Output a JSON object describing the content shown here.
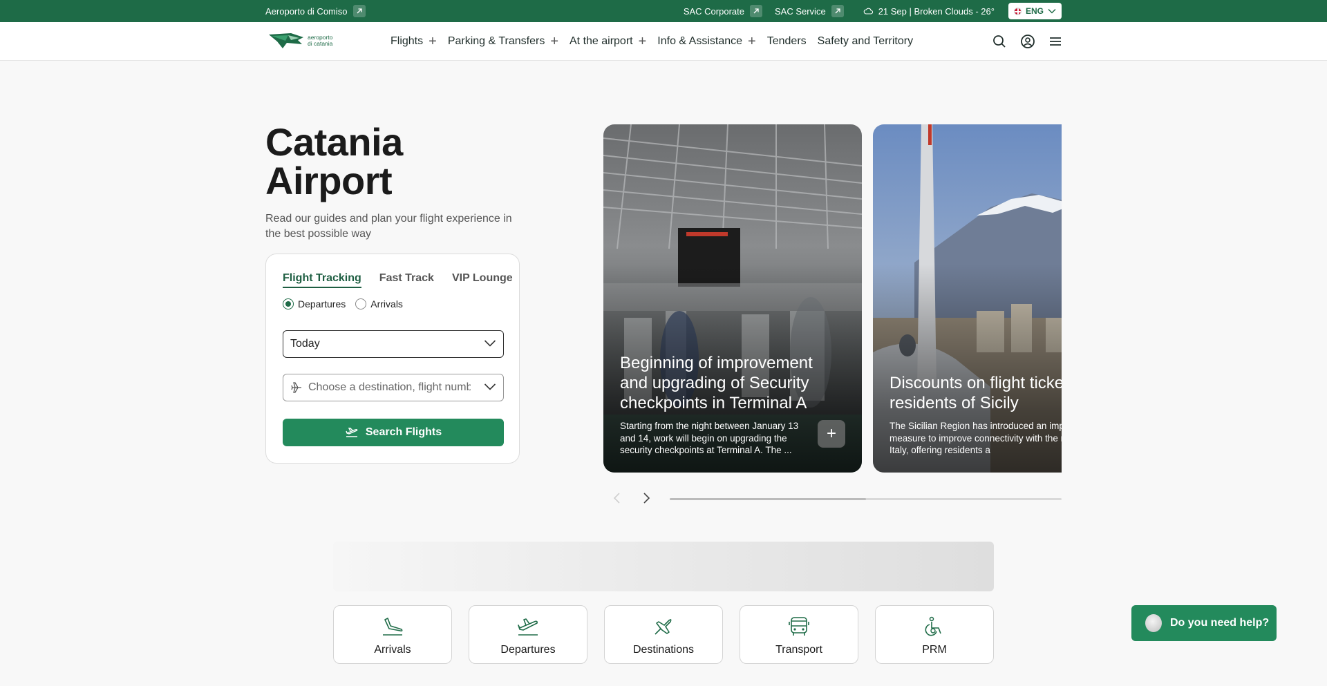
{
  "topbar": {
    "comiso_label": "Aeroporto di Comiso",
    "corporate_label": "SAC Corporate",
    "service_label": "SAC Service",
    "weather": "21 Sep | Broken Clouds - 26°",
    "language": "ENG"
  },
  "logo": {
    "line1": "aeroporto",
    "line2": "di catania"
  },
  "nav": {
    "items": [
      {
        "label": "Flights"
      },
      {
        "label": "Parking & Transfers"
      },
      {
        "label": "At the airport"
      },
      {
        "label": "Info & Assistance"
      },
      {
        "label": "Tenders"
      },
      {
        "label": "Safety and Territory"
      }
    ]
  },
  "hero": {
    "title_line1": "Catania",
    "title_line2": "Airport",
    "subtitle": "Read our guides and plan your flight experience in the best possible way"
  },
  "booking": {
    "tabs": [
      "Flight Tracking",
      "Fast Track",
      "VIP Lounge"
    ],
    "radio_departures": "Departures",
    "radio_arrivals": "Arrivals",
    "date_value": "Today",
    "destination_placeholder": "Choose a destination, flight number or airline",
    "search_label": "Search Flights"
  },
  "news": [
    {
      "title": "Beginning of improvement and upgrading of Security checkpoints  in Terminal A",
      "desc": "Starting from the night between January 13 and 14, work will begin on upgrading the security checkpoints at Terminal A. The ..."
    },
    {
      "title": "Discounts on flight tickets for residents of Sicily",
      "desc": "The Sicilian Region has introduced an important measure to improve connectivity with the rest of Italy, offering residents a"
    }
  ],
  "carousel": {
    "progress": 0.5
  },
  "quick_links": [
    {
      "label": "Arrivals",
      "icon": "arrivals-icon"
    },
    {
      "label": "Departures",
      "icon": "departures-icon"
    },
    {
      "label": "Destinations",
      "icon": "plane-icon"
    },
    {
      "label": "Transport",
      "icon": "bus-icon"
    },
    {
      "label": "PRM",
      "icon": "wheelchair-icon"
    }
  ],
  "help": {
    "label": "Do you need help?"
  },
  "colors": {
    "brand": "#1e6b47",
    "accent": "#238a5c"
  }
}
